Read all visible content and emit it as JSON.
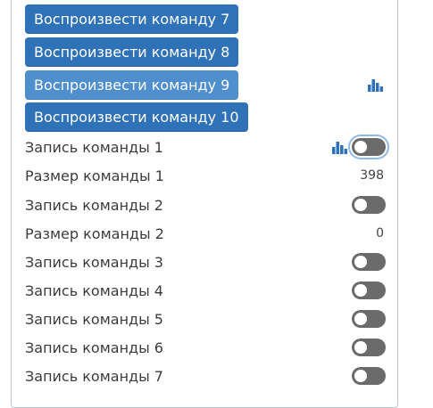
{
  "buttons": [
    {
      "label": "Воспроизвести команду 7"
    },
    {
      "label": "Воспроизвести команду 8"
    },
    {
      "label": "Воспроизвести команду 9"
    },
    {
      "label": "Воспроизвести команду 10"
    }
  ],
  "rows": [
    {
      "label": "Запись команды 1",
      "type": "toggle",
      "checked": false
    },
    {
      "label": "Размер команды 1",
      "type": "value",
      "value": "398"
    },
    {
      "label": "Запись команды 2",
      "type": "toggle",
      "checked": false
    },
    {
      "label": "Размер команды 2",
      "type": "value",
      "value": "0"
    },
    {
      "label": "Запись команды 3",
      "type": "toggle",
      "checked": false
    },
    {
      "label": "Запись команды 4",
      "type": "toggle",
      "checked": false
    },
    {
      "label": "Запись команды 5",
      "type": "toggle",
      "checked": false
    },
    {
      "label": "Запись команды 6",
      "type": "toggle",
      "checked": false
    },
    {
      "label": "Запись команды 7",
      "type": "toggle",
      "checked": false
    }
  ],
  "icons": {
    "history": "bar-chart-icon"
  },
  "colors": {
    "button": "#2f72b8",
    "button_hover": "#4f8fcd",
    "icon": "#2f72b8",
    "toggle_off": "#6b6b6b"
  }
}
